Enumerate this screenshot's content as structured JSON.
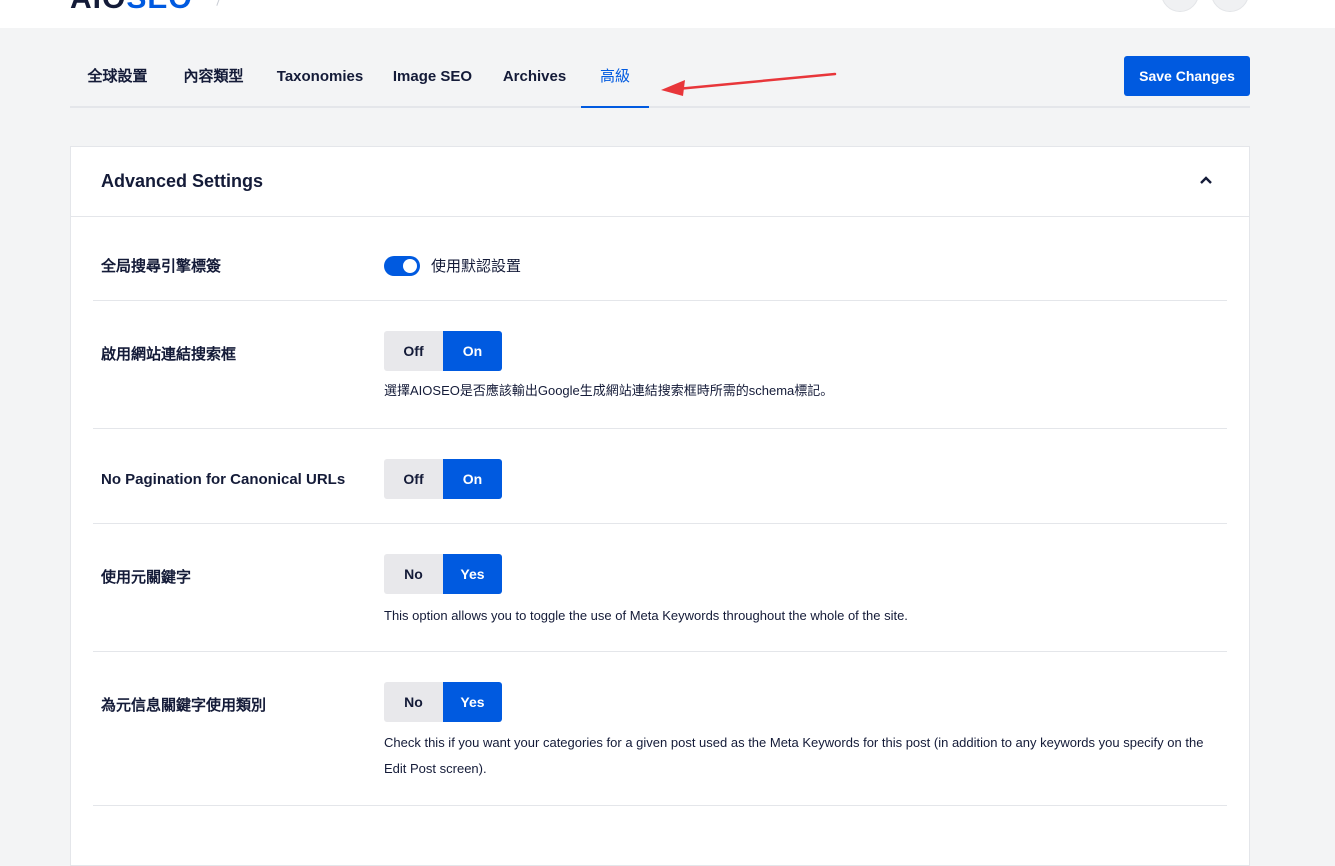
{
  "brand": {
    "logo_main": "AIO",
    "logo_accent": "SEO"
  },
  "tabs": [
    {
      "label": "全球設置"
    },
    {
      "label": "內容類型"
    },
    {
      "label": "Taxonomies"
    },
    {
      "label": "Image SEO"
    },
    {
      "label": "Archives"
    },
    {
      "label": "高級",
      "active": true
    }
  ],
  "toolbar": {
    "save_label": "Save Changes"
  },
  "colors": {
    "accent": "#005ae0",
    "annotation_arrow": "#e8363a"
  },
  "card": {
    "title": "Advanced Settings",
    "rows": [
      {
        "label": "全局搜尋引擎標簽",
        "control": "switch",
        "switch_label": "使用默認設置",
        "value": true
      },
      {
        "label": "啟用網站連結搜索框",
        "control": "radio",
        "options": [
          "Off",
          "On"
        ],
        "selected": "On",
        "description": "選擇AIOSEO是否應該輸出Google生成網站連結搜索框時所需的schema標記。"
      },
      {
        "label": "No Pagination for Canonical URLs",
        "control": "radio",
        "options": [
          "Off",
          "On"
        ],
        "selected": "On"
      },
      {
        "label": "使用元關鍵字",
        "control": "radio",
        "options": [
          "No",
          "Yes"
        ],
        "selected": "Yes",
        "description": "This option allows you to toggle the use of Meta Keywords throughout the whole of the site."
      },
      {
        "label": "為元信息關鍵字使用類別",
        "control": "radio",
        "options": [
          "No",
          "Yes"
        ],
        "selected": "Yes",
        "description": "Check this if you want your categories for a given post used as the Meta Keywords for this post (in addition to any keywords you specify on the Edit Post screen)."
      }
    ]
  }
}
